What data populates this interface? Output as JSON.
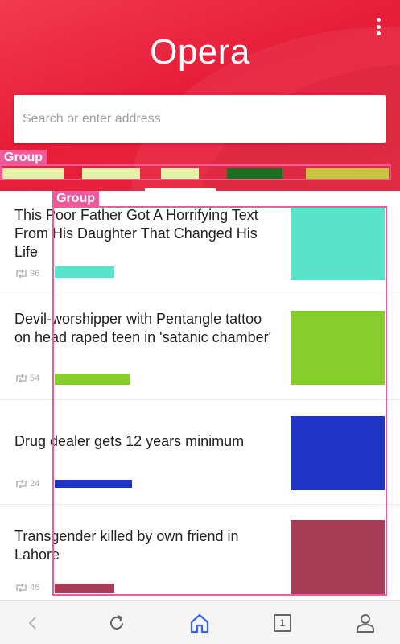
{
  "header": {
    "logo": "Opera",
    "search_placeholder": "Search or enter address",
    "speed_dial_label": "Group",
    "speed_dial_colors": [
      "#e5f0a8",
      "#e5f0a8",
      "#e5f0a8",
      "#1e6e22",
      "#c9c43e"
    ]
  },
  "feed": {
    "group_label": "Group",
    "articles": [
      {
        "title": "This Poor Father Got A Horrifying Text From His Daughter That Changed His Life",
        "count": "96",
        "thumb_color": "#57e4cb",
        "source_color": "#57e4cb"
      },
      {
        "title": "Devil-worshipper with Pentangle tattoo on head raped teen in 'satanic chamber'",
        "count": "54",
        "thumb_color": "#87cd2c",
        "source_color": "#87cd2c"
      },
      {
        "title": "Drug dealer gets 12 years minimum",
        "count": "24",
        "thumb_color": "#1e35c8",
        "source_color": "#1e35c8"
      },
      {
        "title": "Transgender killed by own friend in Lahore",
        "count": "46",
        "thumb_color": "#a63c55",
        "source_color": "#a63c55"
      }
    ]
  },
  "bottom_nav": {
    "tabs_count": "1",
    "active_color": "#3a62e4",
    "icon_color": "#666666"
  }
}
